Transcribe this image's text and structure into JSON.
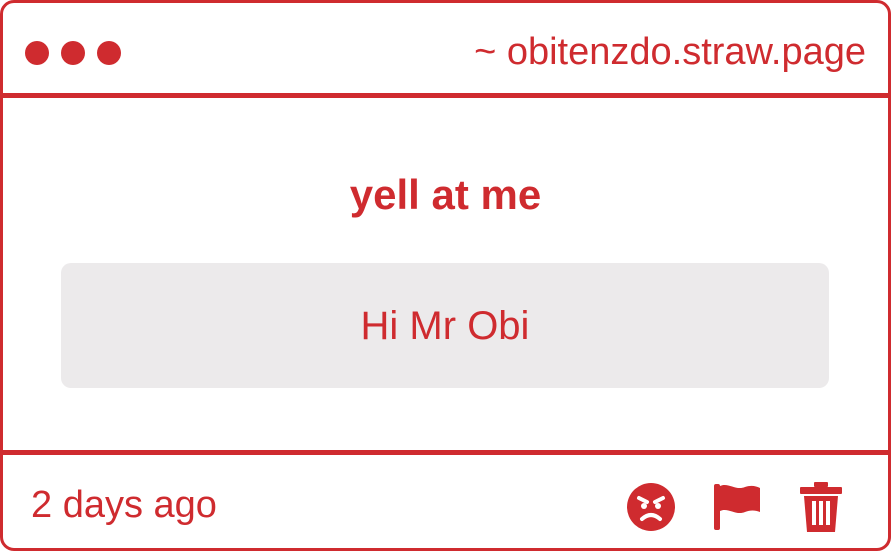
{
  "window": {
    "url": "~ obitenzdo.straw.page"
  },
  "question": {
    "title": "yell at me",
    "message": "Hi Mr Obi"
  },
  "footer": {
    "timestamp": "2 days ago"
  },
  "icons": {
    "react": "angry-face-icon",
    "report": "flag-icon",
    "delete": "trash-icon"
  },
  "colors": {
    "accent": "#cf2b2f",
    "message_background": "#eceaeb"
  }
}
